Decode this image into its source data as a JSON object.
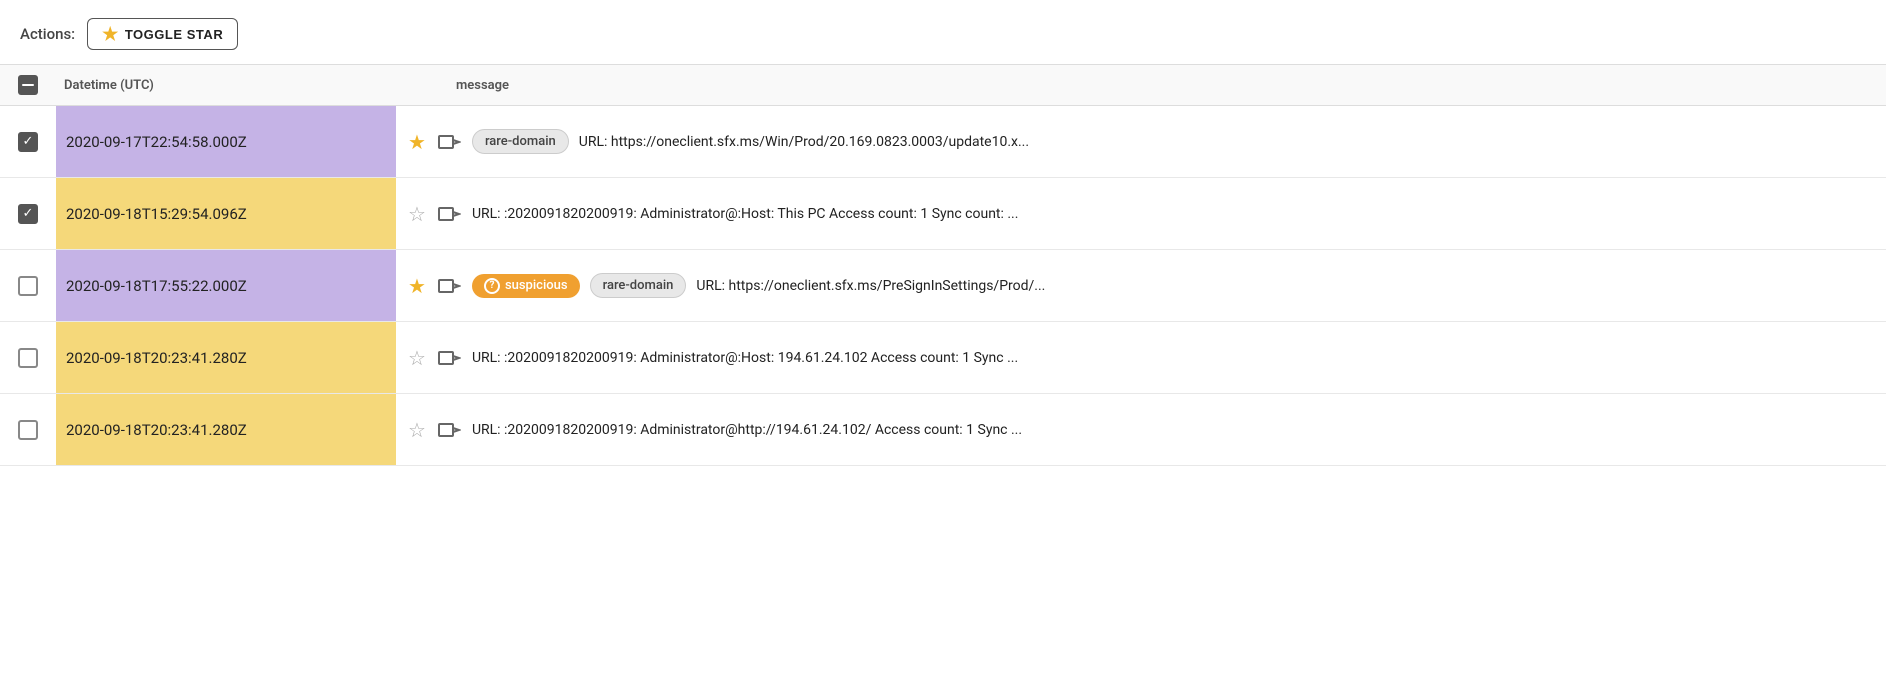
{
  "actions": {
    "label": "Actions:",
    "toggle_star_label": "TOGGLE STAR"
  },
  "table": {
    "header": {
      "datetime_col": "Datetime (UTC)",
      "message_col": "message"
    },
    "rows": [
      {
        "id": "row-1",
        "checked": true,
        "bg": "purple",
        "datetime": "2020-09-17T22:54:58.000Z",
        "starred": true,
        "badges": [
          "rare-domain"
        ],
        "message": "URL: https://oneclient.sfx.ms/Win/Prod/20.169.0823.0003/update10.x..."
      },
      {
        "id": "row-2",
        "checked": true,
        "bg": "yellow",
        "datetime": "2020-09-18T15:29:54.096Z",
        "starred": false,
        "badges": [],
        "message": "URL: :2020091820200919: Administrator@:Host: This PC Access count: 1 Sync count: ..."
      },
      {
        "id": "row-3",
        "checked": false,
        "bg": "purple",
        "datetime": "2020-09-18T17:55:22.000Z",
        "starred": true,
        "badges": [
          "suspicious",
          "rare-domain"
        ],
        "message": "URL: https://oneclient.sfx.ms/PreSignInSettings/Prod/..."
      },
      {
        "id": "row-4",
        "checked": false,
        "bg": "yellow",
        "datetime": "2020-09-18T20:23:41.280Z",
        "starred": false,
        "badges": [],
        "message": "URL: :2020091820200919: Administrator@:Host: 194.61.24.102 Access count: 1 Sync ..."
      },
      {
        "id": "row-5",
        "checked": false,
        "bg": "yellow",
        "datetime": "2020-09-18T20:23:41.280Z",
        "starred": false,
        "badges": [],
        "message": "URL: :2020091820200919: Administrator@http://194.61.24.102/ Access count: 1 Sync ..."
      }
    ]
  },
  "icons": {
    "star_filled": "★",
    "star_empty": "☆",
    "checkmark": "✓"
  }
}
